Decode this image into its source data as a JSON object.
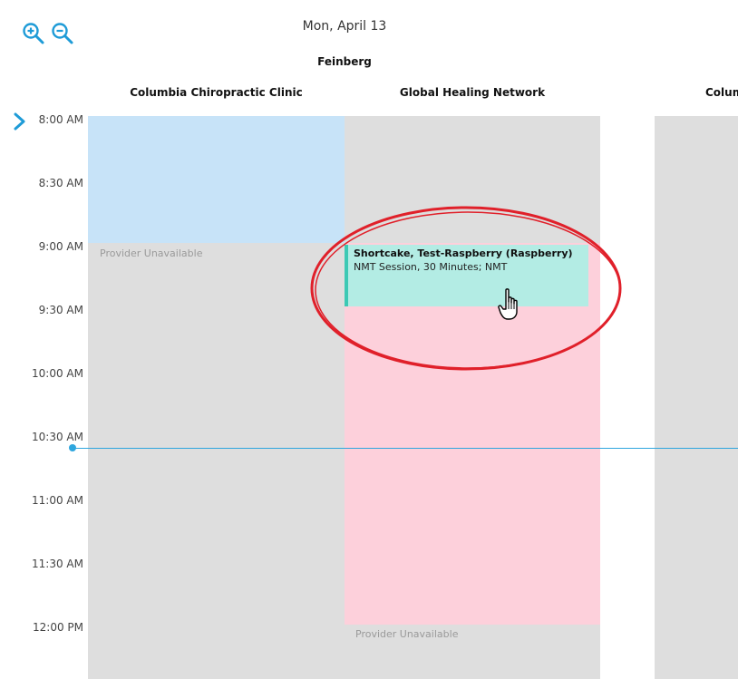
{
  "header": {
    "date": "Mon, April 13",
    "provider": "Feinberg"
  },
  "toolbar": {
    "zoom_in_icon": "zoom-in-icon",
    "zoom_out_icon": "zoom-out-icon",
    "next_icon": "chevron-right-icon"
  },
  "columns": [
    {
      "label": "Columbia Chiropractic Clinic"
    },
    {
      "label": "Global Healing Network"
    },
    {
      "label": "Colum"
    }
  ],
  "times": [
    "8:00 AM",
    "8:30 AM",
    "9:00 AM",
    "9:30 AM",
    "10:00 AM",
    "10:30 AM",
    "11:00 AM",
    "11:30 AM",
    "12:00 PM"
  ],
  "unavailable": {
    "col1": "Provider Unavailable",
    "col2": "Provider Unavailable"
  },
  "appointment": {
    "title": "Shortcake, Test-Raspberry (Raspberry)",
    "subtitle": "NMT Session, 30 Minutes; NMT"
  },
  "colors": {
    "accent": "#2ea6de",
    "appointment_bg": "#b3ece4",
    "appointment_border": "#3cc9b4",
    "unavailable_pink": "#fdd0db",
    "available_blue": "#c7e3f8",
    "grid_gray": "#dedede",
    "annotation_red": "#e0202a"
  }
}
